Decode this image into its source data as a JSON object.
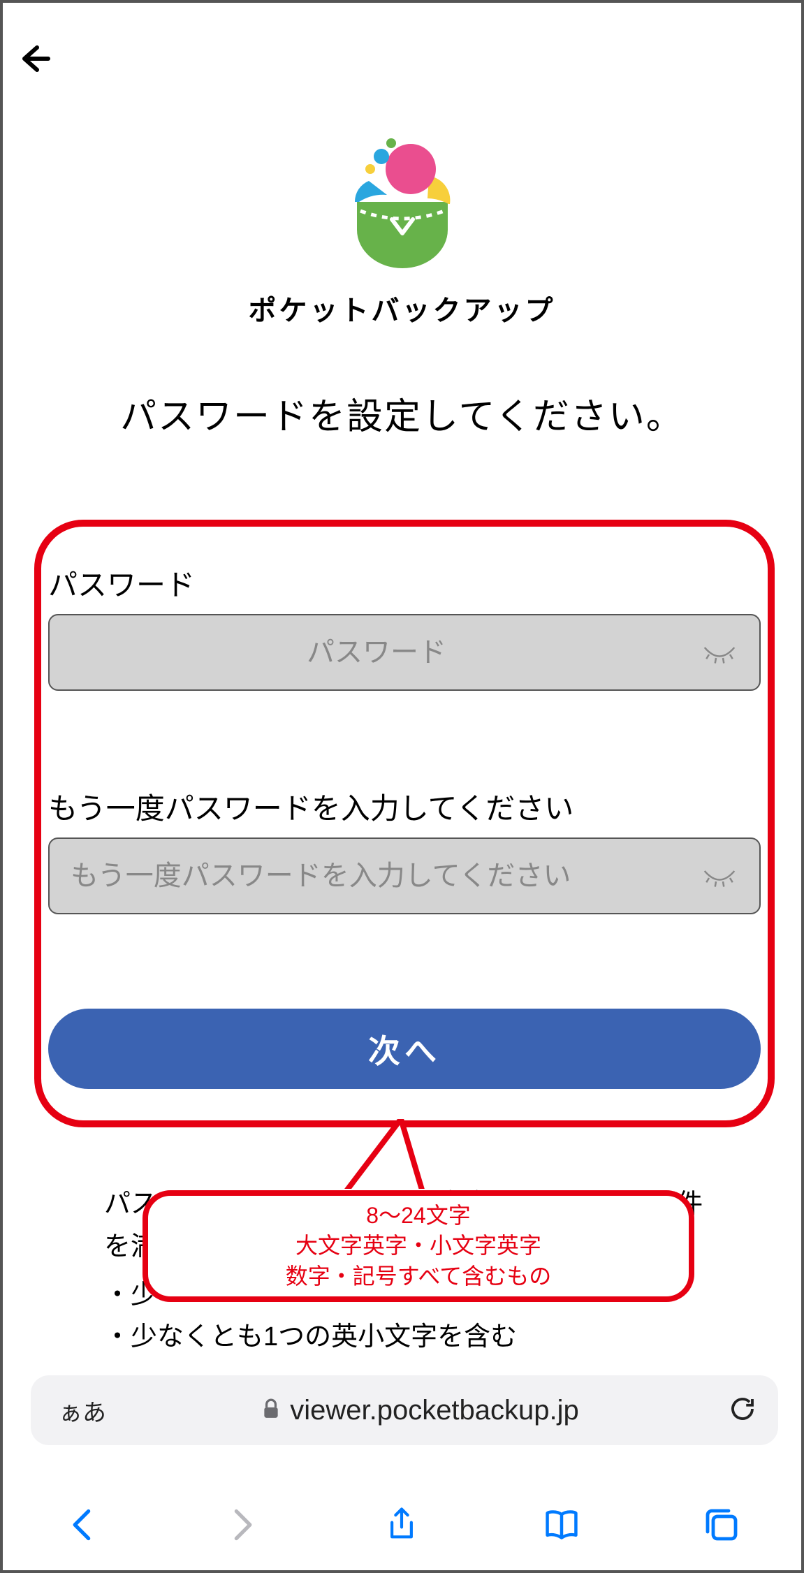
{
  "nav": {
    "back_label": "back"
  },
  "brand": {
    "name": "ポケットバックアップ"
  },
  "headline": "パスワードを設定してください。",
  "form": {
    "password_label": "パスワード",
    "password_placeholder": "パスワード",
    "password_value": "",
    "confirm_label": "もう一度パスワードを入力してください",
    "confirm_placeholder": "もう一度パスワードを入力してください",
    "confirm_value": "",
    "next_button": "次へ"
  },
  "requirements": {
    "intro_visible": "パスワード　　　　　　4　文字で　　以下の要件を満たし",
    "bullet_lower_partial": "少",
    "bullet_lower": "少なくとも1つの英小文字を含む"
  },
  "annotation": {
    "line1": "8〜24文字",
    "line2": "大文字英字・小文字英字",
    "line3": "数字・記号すべて含むもの"
  },
  "browser": {
    "aa": "ぁあ",
    "url": "viewer.pocketbackup.jp"
  },
  "colors": {
    "accent_red": "#e60012",
    "primary_blue": "#3b63b2",
    "ios_blue": "#007aff"
  }
}
